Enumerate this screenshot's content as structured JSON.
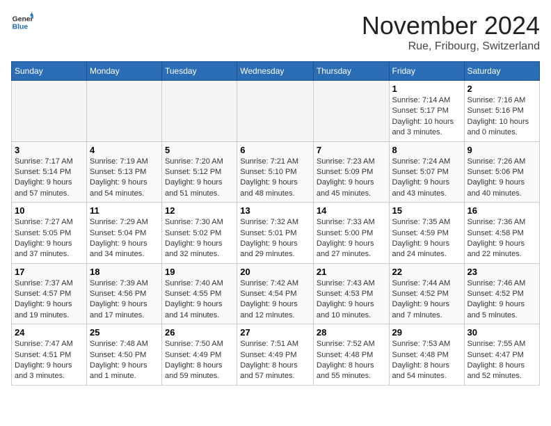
{
  "logo": {
    "text_general": "General",
    "text_blue": "Blue"
  },
  "header": {
    "month": "November 2024",
    "location": "Rue, Fribourg, Switzerland"
  },
  "days_of_week": [
    "Sunday",
    "Monday",
    "Tuesday",
    "Wednesday",
    "Thursday",
    "Friday",
    "Saturday"
  ],
  "weeks": [
    [
      {
        "day": "",
        "info": ""
      },
      {
        "day": "",
        "info": ""
      },
      {
        "day": "",
        "info": ""
      },
      {
        "day": "",
        "info": ""
      },
      {
        "day": "",
        "info": ""
      },
      {
        "day": "1",
        "info": "Sunrise: 7:14 AM\nSunset: 5:17 PM\nDaylight: 10 hours and 3 minutes."
      },
      {
        "day": "2",
        "info": "Sunrise: 7:16 AM\nSunset: 5:16 PM\nDaylight: 10 hours and 0 minutes."
      }
    ],
    [
      {
        "day": "3",
        "info": "Sunrise: 7:17 AM\nSunset: 5:14 PM\nDaylight: 9 hours and 57 minutes."
      },
      {
        "day": "4",
        "info": "Sunrise: 7:19 AM\nSunset: 5:13 PM\nDaylight: 9 hours and 54 minutes."
      },
      {
        "day": "5",
        "info": "Sunrise: 7:20 AM\nSunset: 5:12 PM\nDaylight: 9 hours and 51 minutes."
      },
      {
        "day": "6",
        "info": "Sunrise: 7:21 AM\nSunset: 5:10 PM\nDaylight: 9 hours and 48 minutes."
      },
      {
        "day": "7",
        "info": "Sunrise: 7:23 AM\nSunset: 5:09 PM\nDaylight: 9 hours and 45 minutes."
      },
      {
        "day": "8",
        "info": "Sunrise: 7:24 AM\nSunset: 5:07 PM\nDaylight: 9 hours and 43 minutes."
      },
      {
        "day": "9",
        "info": "Sunrise: 7:26 AM\nSunset: 5:06 PM\nDaylight: 9 hours and 40 minutes."
      }
    ],
    [
      {
        "day": "10",
        "info": "Sunrise: 7:27 AM\nSunset: 5:05 PM\nDaylight: 9 hours and 37 minutes."
      },
      {
        "day": "11",
        "info": "Sunrise: 7:29 AM\nSunset: 5:04 PM\nDaylight: 9 hours and 34 minutes."
      },
      {
        "day": "12",
        "info": "Sunrise: 7:30 AM\nSunset: 5:02 PM\nDaylight: 9 hours and 32 minutes."
      },
      {
        "day": "13",
        "info": "Sunrise: 7:32 AM\nSunset: 5:01 PM\nDaylight: 9 hours and 29 minutes."
      },
      {
        "day": "14",
        "info": "Sunrise: 7:33 AM\nSunset: 5:00 PM\nDaylight: 9 hours and 27 minutes."
      },
      {
        "day": "15",
        "info": "Sunrise: 7:35 AM\nSunset: 4:59 PM\nDaylight: 9 hours and 24 minutes."
      },
      {
        "day": "16",
        "info": "Sunrise: 7:36 AM\nSunset: 4:58 PM\nDaylight: 9 hours and 22 minutes."
      }
    ],
    [
      {
        "day": "17",
        "info": "Sunrise: 7:37 AM\nSunset: 4:57 PM\nDaylight: 9 hours and 19 minutes."
      },
      {
        "day": "18",
        "info": "Sunrise: 7:39 AM\nSunset: 4:56 PM\nDaylight: 9 hours and 17 minutes."
      },
      {
        "day": "19",
        "info": "Sunrise: 7:40 AM\nSunset: 4:55 PM\nDaylight: 9 hours and 14 minutes."
      },
      {
        "day": "20",
        "info": "Sunrise: 7:42 AM\nSunset: 4:54 PM\nDaylight: 9 hours and 12 minutes."
      },
      {
        "day": "21",
        "info": "Sunrise: 7:43 AM\nSunset: 4:53 PM\nDaylight: 9 hours and 10 minutes."
      },
      {
        "day": "22",
        "info": "Sunrise: 7:44 AM\nSunset: 4:52 PM\nDaylight: 9 hours and 7 minutes."
      },
      {
        "day": "23",
        "info": "Sunrise: 7:46 AM\nSunset: 4:52 PM\nDaylight: 9 hours and 5 minutes."
      }
    ],
    [
      {
        "day": "24",
        "info": "Sunrise: 7:47 AM\nSunset: 4:51 PM\nDaylight: 9 hours and 3 minutes."
      },
      {
        "day": "25",
        "info": "Sunrise: 7:48 AM\nSunset: 4:50 PM\nDaylight: 9 hours and 1 minute."
      },
      {
        "day": "26",
        "info": "Sunrise: 7:50 AM\nSunset: 4:49 PM\nDaylight: 8 hours and 59 minutes."
      },
      {
        "day": "27",
        "info": "Sunrise: 7:51 AM\nSunset: 4:49 PM\nDaylight: 8 hours and 57 minutes."
      },
      {
        "day": "28",
        "info": "Sunrise: 7:52 AM\nSunset: 4:48 PM\nDaylight: 8 hours and 55 minutes."
      },
      {
        "day": "29",
        "info": "Sunrise: 7:53 AM\nSunset: 4:48 PM\nDaylight: 8 hours and 54 minutes."
      },
      {
        "day": "30",
        "info": "Sunrise: 7:55 AM\nSunset: 4:47 PM\nDaylight: 8 hours and 52 minutes."
      }
    ]
  ]
}
